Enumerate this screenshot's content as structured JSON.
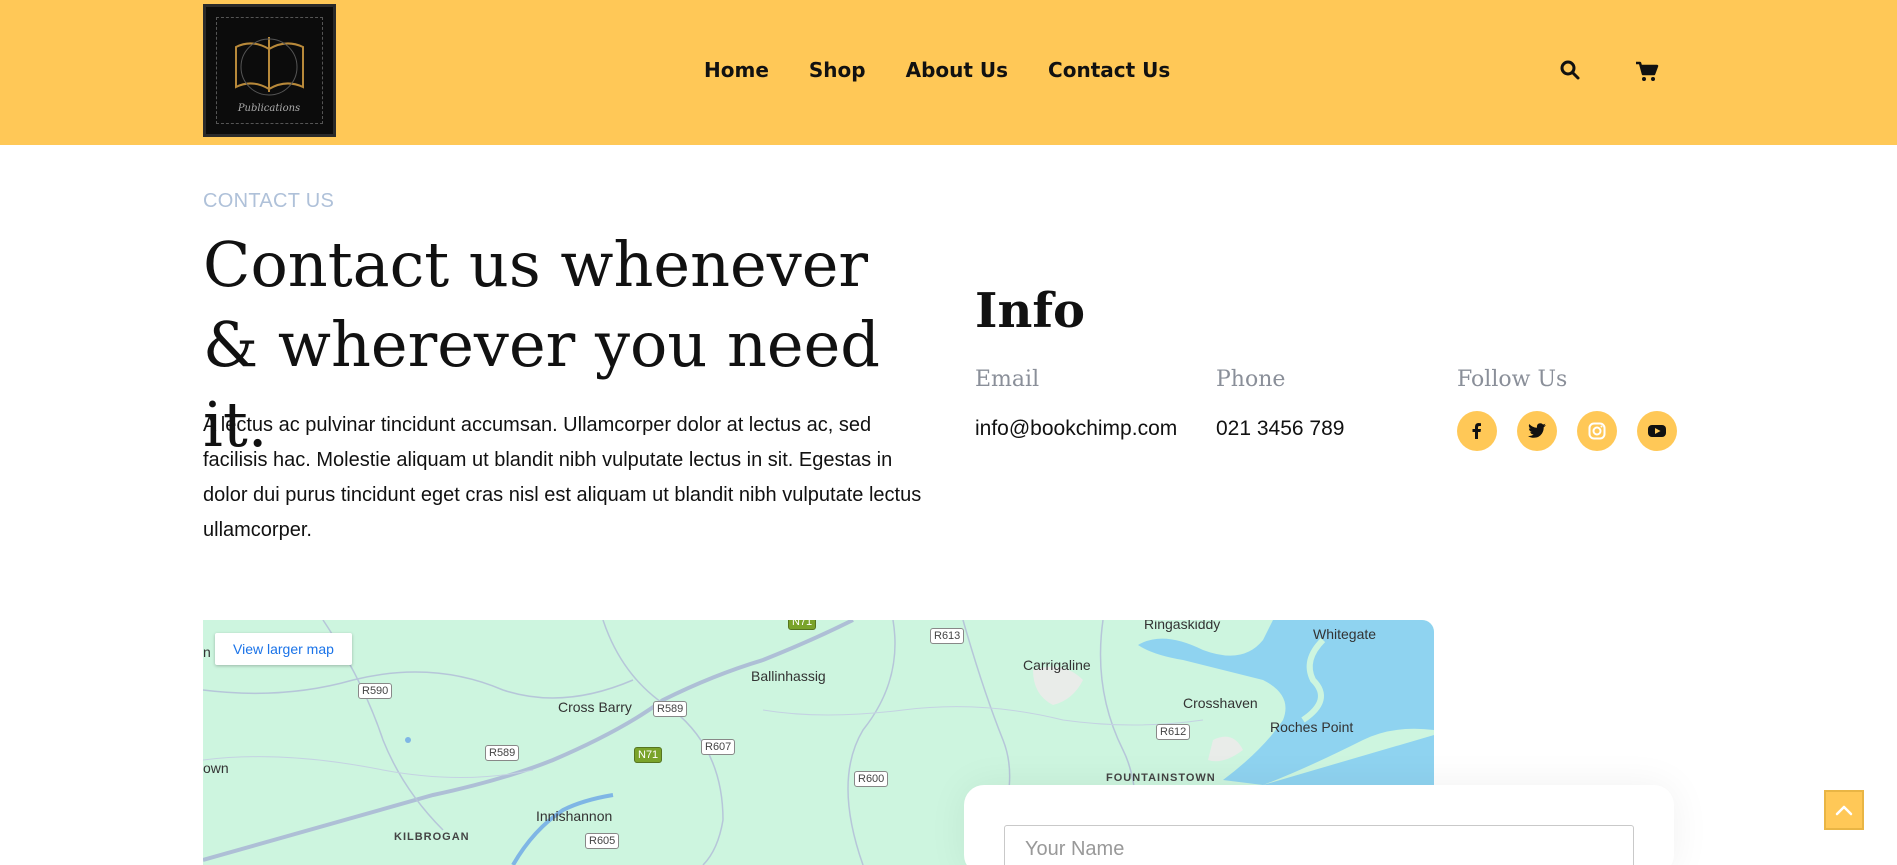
{
  "colors": {
    "accent": "#FFC857",
    "eyebrow": "#AFC1D9",
    "muted": "#8a8f99",
    "link": "#1a73e8"
  },
  "header": {
    "logo_icon": "open-book-logo",
    "nav": [
      {
        "label": "Home"
      },
      {
        "label": "Shop"
      },
      {
        "label": "About Us"
      },
      {
        "label": "Contact Us"
      }
    ],
    "icons": [
      "search-icon",
      "cart-icon"
    ]
  },
  "hero": {
    "eyebrow": "CONTACT US",
    "headline": "Contact us whenever & wherever you need it.",
    "body": "A lectus ac pulvinar tincidunt accumsan. Ullamcorper dolor at lectus ac, sed facilisis hac. Molestie aliquam ut blandit nibh vulputate lectus in sit. Egestas in dolor dui purus tincidunt eget cras nisl est aliquam ut blandit nibh vulputate lectus ullamcorper."
  },
  "info": {
    "title": "Info",
    "email_label": "Email",
    "email_value": "info@bookchimp.com",
    "phone_label": "Phone",
    "phone_value": "021 3456 789",
    "follow_label": "Follow Us",
    "social": [
      "facebook-icon",
      "twitter-icon",
      "instagram-icon",
      "youtube-icon"
    ]
  },
  "map": {
    "view_larger": "View larger map",
    "places": [
      "Ringaskiddy",
      "Whitegate",
      "Carrigaline",
      "Ballinhassig",
      "Cross Barry",
      "Crosshaven",
      "Roches Point",
      "FOUNTAINSTOWN",
      "Innishannon",
      "KILBROGAN",
      "own",
      "n"
    ],
    "roads": [
      "R613",
      "R590",
      "R589",
      "R589",
      "N71",
      "N71",
      "R607",
      "R612",
      "R600",
      "R605"
    ]
  },
  "form": {
    "name_placeholder": "Your Name"
  },
  "scroll_top_icon": "chevron-up-icon"
}
